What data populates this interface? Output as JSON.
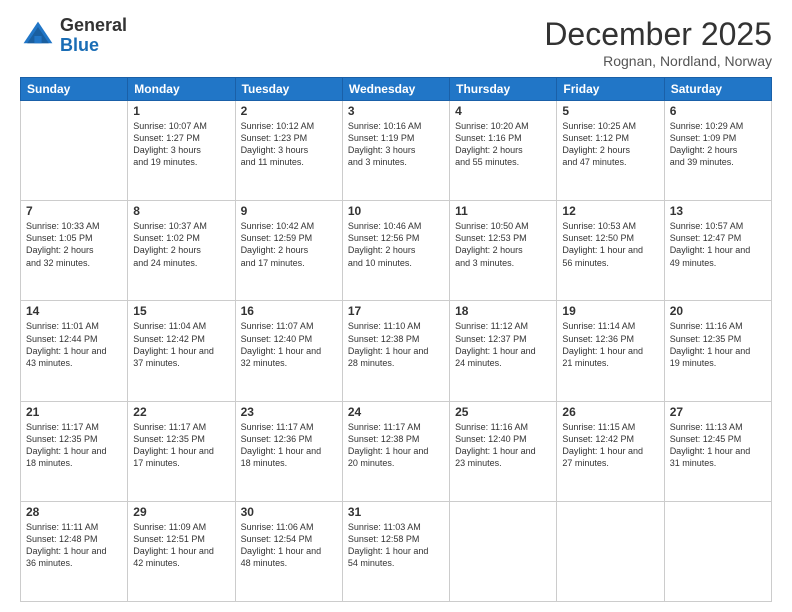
{
  "logo": {
    "text_general": "General",
    "text_blue": "Blue"
  },
  "header": {
    "month_title": "December 2025",
    "location": "Rognan, Nordland, Norway"
  },
  "weekdays": [
    "Sunday",
    "Monday",
    "Tuesday",
    "Wednesday",
    "Thursday",
    "Friday",
    "Saturday"
  ],
  "weeks": [
    [
      {
        "day": "",
        "info": ""
      },
      {
        "day": "1",
        "info": "Sunrise: 10:07 AM\nSunset: 1:27 PM\nDaylight: 3 hours\nand 19 minutes."
      },
      {
        "day": "2",
        "info": "Sunrise: 10:12 AM\nSunset: 1:23 PM\nDaylight: 3 hours\nand 11 minutes."
      },
      {
        "day": "3",
        "info": "Sunrise: 10:16 AM\nSunset: 1:19 PM\nDaylight: 3 hours\nand 3 minutes."
      },
      {
        "day": "4",
        "info": "Sunrise: 10:20 AM\nSunset: 1:16 PM\nDaylight: 2 hours\nand 55 minutes."
      },
      {
        "day": "5",
        "info": "Sunrise: 10:25 AM\nSunset: 1:12 PM\nDaylight: 2 hours\nand 47 minutes."
      },
      {
        "day": "6",
        "info": "Sunrise: 10:29 AM\nSunset: 1:09 PM\nDaylight: 2 hours\nand 39 minutes."
      }
    ],
    [
      {
        "day": "7",
        "info": "Sunrise: 10:33 AM\nSunset: 1:05 PM\nDaylight: 2 hours\nand 32 minutes."
      },
      {
        "day": "8",
        "info": "Sunrise: 10:37 AM\nSunset: 1:02 PM\nDaylight: 2 hours\nand 24 minutes."
      },
      {
        "day": "9",
        "info": "Sunrise: 10:42 AM\nSunset: 12:59 PM\nDaylight: 2 hours\nand 17 minutes."
      },
      {
        "day": "10",
        "info": "Sunrise: 10:46 AM\nSunset: 12:56 PM\nDaylight: 2 hours\nand 10 minutes."
      },
      {
        "day": "11",
        "info": "Sunrise: 10:50 AM\nSunset: 12:53 PM\nDaylight: 2 hours\nand 3 minutes."
      },
      {
        "day": "12",
        "info": "Sunrise: 10:53 AM\nSunset: 12:50 PM\nDaylight: 1 hour and\n56 minutes."
      },
      {
        "day": "13",
        "info": "Sunrise: 10:57 AM\nSunset: 12:47 PM\nDaylight: 1 hour and\n49 minutes."
      }
    ],
    [
      {
        "day": "14",
        "info": "Sunrise: 11:01 AM\nSunset: 12:44 PM\nDaylight: 1 hour and\n43 minutes."
      },
      {
        "day": "15",
        "info": "Sunrise: 11:04 AM\nSunset: 12:42 PM\nDaylight: 1 hour and\n37 minutes."
      },
      {
        "day": "16",
        "info": "Sunrise: 11:07 AM\nSunset: 12:40 PM\nDaylight: 1 hour and\n32 minutes."
      },
      {
        "day": "17",
        "info": "Sunrise: 11:10 AM\nSunset: 12:38 PM\nDaylight: 1 hour and\n28 minutes."
      },
      {
        "day": "18",
        "info": "Sunrise: 11:12 AM\nSunset: 12:37 PM\nDaylight: 1 hour and\n24 minutes."
      },
      {
        "day": "19",
        "info": "Sunrise: 11:14 AM\nSunset: 12:36 PM\nDaylight: 1 hour and\n21 minutes."
      },
      {
        "day": "20",
        "info": "Sunrise: 11:16 AM\nSunset: 12:35 PM\nDaylight: 1 hour and\n19 minutes."
      }
    ],
    [
      {
        "day": "21",
        "info": "Sunrise: 11:17 AM\nSunset: 12:35 PM\nDaylight: 1 hour and\n18 minutes."
      },
      {
        "day": "22",
        "info": "Sunrise: 11:17 AM\nSunset: 12:35 PM\nDaylight: 1 hour and\n17 minutes."
      },
      {
        "day": "23",
        "info": "Sunrise: 11:17 AM\nSunset: 12:36 PM\nDaylight: 1 hour and\n18 minutes."
      },
      {
        "day": "24",
        "info": "Sunrise: 11:17 AM\nSunset: 12:38 PM\nDaylight: 1 hour and\n20 minutes."
      },
      {
        "day": "25",
        "info": "Sunrise: 11:16 AM\nSunset: 12:40 PM\nDaylight: 1 hour and\n23 minutes."
      },
      {
        "day": "26",
        "info": "Sunrise: 11:15 AM\nSunset: 12:42 PM\nDaylight: 1 hour and\n27 minutes."
      },
      {
        "day": "27",
        "info": "Sunrise: 11:13 AM\nSunset: 12:45 PM\nDaylight: 1 hour and\n31 minutes."
      }
    ],
    [
      {
        "day": "28",
        "info": "Sunrise: 11:11 AM\nSunset: 12:48 PM\nDaylight: 1 hour and\n36 minutes."
      },
      {
        "day": "29",
        "info": "Sunrise: 11:09 AM\nSunset: 12:51 PM\nDaylight: 1 hour and\n42 minutes."
      },
      {
        "day": "30",
        "info": "Sunrise: 11:06 AM\nSunset: 12:54 PM\nDaylight: 1 hour and\n48 minutes."
      },
      {
        "day": "31",
        "info": "Sunrise: 11:03 AM\nSunset: 12:58 PM\nDaylight: 1 hour and\n54 minutes."
      },
      {
        "day": "",
        "info": ""
      },
      {
        "day": "",
        "info": ""
      },
      {
        "day": "",
        "info": ""
      }
    ]
  ]
}
